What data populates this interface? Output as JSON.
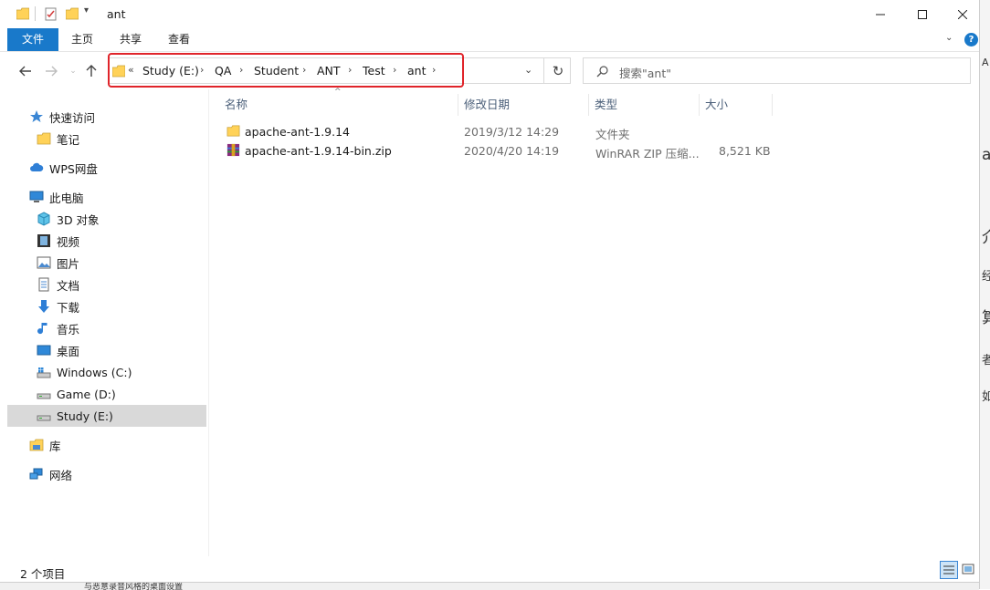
{
  "window": {
    "title": "ant"
  },
  "ribbon": {
    "tabs": [
      {
        "label": "文件",
        "active": true
      },
      {
        "label": "主页",
        "active": false
      },
      {
        "label": "共享",
        "active": false
      },
      {
        "label": "查看",
        "active": false
      }
    ]
  },
  "address": {
    "overflow": "«",
    "crumbs": [
      "Study (E:)",
      "QA",
      "Student",
      "ANT",
      "Test",
      "ant"
    ],
    "separator": "›",
    "highlight_color": "#e0242a"
  },
  "search": {
    "placeholder": "搜索\"ant\""
  },
  "nav": {
    "quick_access": "快速访问",
    "notes": "笔记",
    "wps": "WPS网盘",
    "this_pc": "此电脑",
    "objects3d": "3D 对象",
    "videos": "视频",
    "pictures": "图片",
    "documents": "文档",
    "downloads": "下载",
    "music": "音乐",
    "desktop": "桌面",
    "drive_c": "Windows (C:)",
    "drive_d": "Game (D:)",
    "drive_e": "Study (E:)",
    "libraries": "库",
    "network": "网络"
  },
  "columns": {
    "name": "名称",
    "modified": "修改日期",
    "type": "类型",
    "size": "大小"
  },
  "files": [
    {
      "name": "apache-ant-1.9.14",
      "modified": "2019/3/12 14:29",
      "type": "文件夹",
      "size": "",
      "icon": "folder-icon"
    },
    {
      "name": "apache-ant-1.9.14-bin.zip",
      "modified": "2020/4/20 14:19",
      "type": "WinRAR ZIP 压缩...",
      "size": "8,521 KB",
      "icon": "winrar-icon"
    }
  ],
  "status": {
    "count": "2 个项目"
  },
  "colors": {
    "accent": "#1979ca",
    "folder": "#ffd258",
    "selection": "#d9d9d9"
  },
  "background_fragments": {
    "right": [
      "A",
      "ar",
      "介",
      "经",
      "算",
      "者",
      "如"
    ],
    "bottom": "与恶意录音风格的桌面设置"
  }
}
